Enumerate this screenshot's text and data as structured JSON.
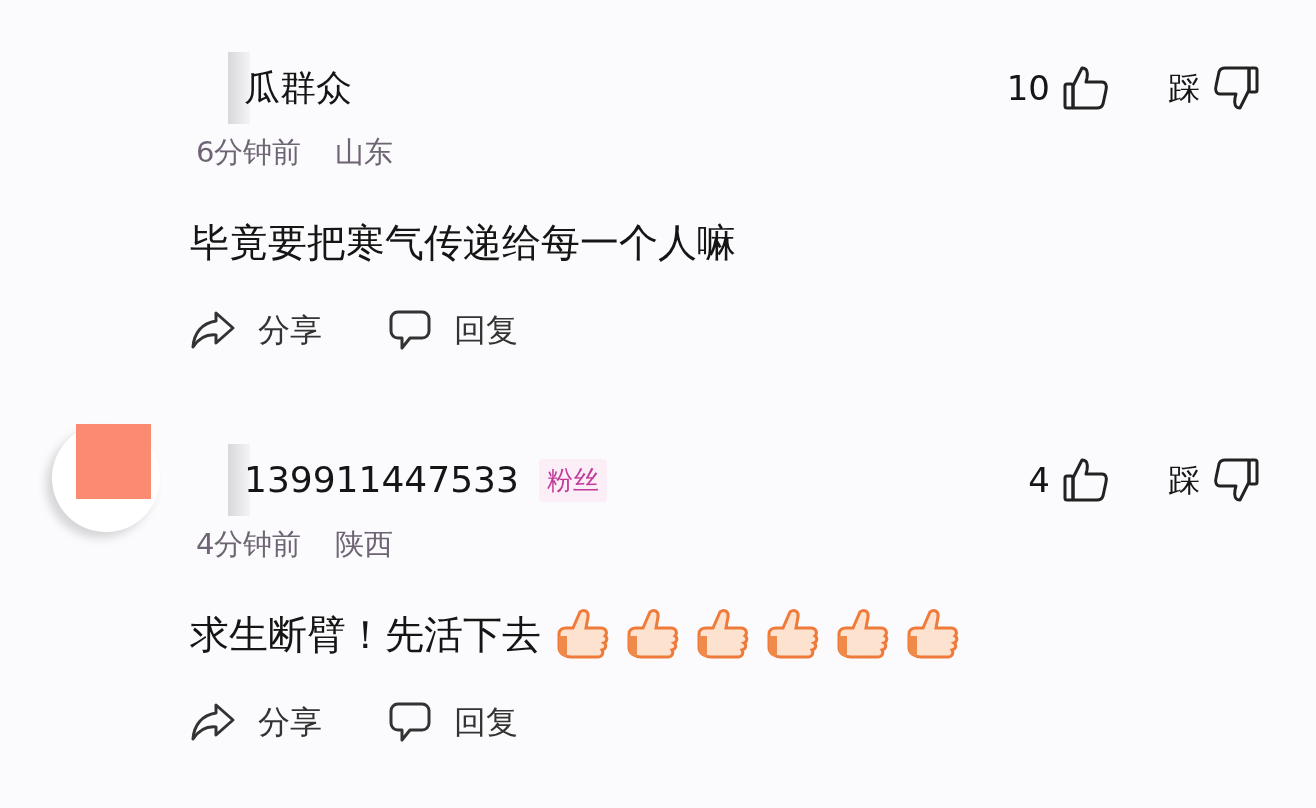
{
  "comments": [
    {
      "avatar": false,
      "username": "瓜群众",
      "likes": "10",
      "dislike_label": "踩",
      "time": "6分钟前",
      "location": "山东",
      "text": "毕竟要把寒气传递给每一个人嘛",
      "actions": [
        {
          "kind": "share",
          "label": "分享"
        },
        {
          "kind": "reply",
          "label": "回复"
        }
      ]
    },
    {
      "avatar": true,
      "username": "139911447533",
      "badge": "粉丝",
      "likes": "4",
      "dislike_label": "踩",
      "time": "4分钟前",
      "location": "陕西",
      "text": "求生断臂！先活下去",
      "reactions": [
        {
          "kind": "thumbs-up"
        },
        {
          "kind": "thumbs-up"
        },
        {
          "kind": "thumbs-up"
        },
        {
          "kind": "thumbs-up"
        },
        {
          "kind": "thumbs-up"
        },
        {
          "kind": "thumbs-up"
        }
      ],
      "actions": [
        {
          "kind": "share",
          "label": "分享"
        },
        {
          "kind": "reply",
          "label": "回复"
        }
      ]
    }
  ]
}
